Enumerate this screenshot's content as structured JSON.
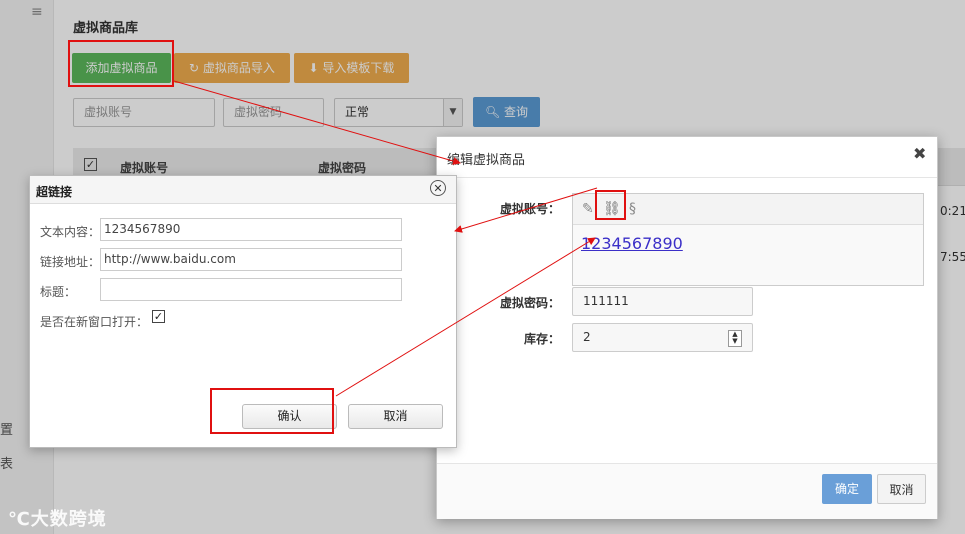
{
  "sidebar": {
    "menu_icon": "≡",
    "item_setting_partial": "置",
    "item_report_partial": "表"
  },
  "page": {
    "title": "虚拟商品库",
    "buttons": {
      "add": "添加虚拟商品",
      "import": "虚拟商品导入",
      "template": "导入模板下载",
      "query": "查询"
    },
    "filters": {
      "account_placeholder": "虚拟账号",
      "password_placeholder": "虚拟密码",
      "status_value": "正常"
    },
    "table": {
      "col_account": "虚拟账号",
      "col_password": "虚拟密码",
      "row_times": [
        "0:21",
        "7:55"
      ]
    }
  },
  "edit_dialog": {
    "title": "编辑虚拟商品",
    "close": "✖",
    "label_account": "虚拟账号：",
    "account_link_text": "1234567890",
    "label_password": "虚拟密码：",
    "password_value": "111111",
    "label_stock": "库存：",
    "stock_value": "2",
    "ok": "确定",
    "cancel": "取消"
  },
  "link_dialog": {
    "title": "超链接",
    "close": "✕",
    "label_text": "文本内容：",
    "text_value": "1234567890",
    "label_url": "链接地址：",
    "url_value": "http://www.baidu.com",
    "label_title": "标题：",
    "title_value": "",
    "label_new_window": "是否在新窗口打开：",
    "new_window_checked": true,
    "ok": "确认",
    "cancel": "取消"
  },
  "watermark": "大数跨境",
  "colors": {
    "annotation": "#e01010",
    "success": "#5cb85c",
    "warning": "#f0ad4e",
    "primary": "#5b9bd5"
  }
}
